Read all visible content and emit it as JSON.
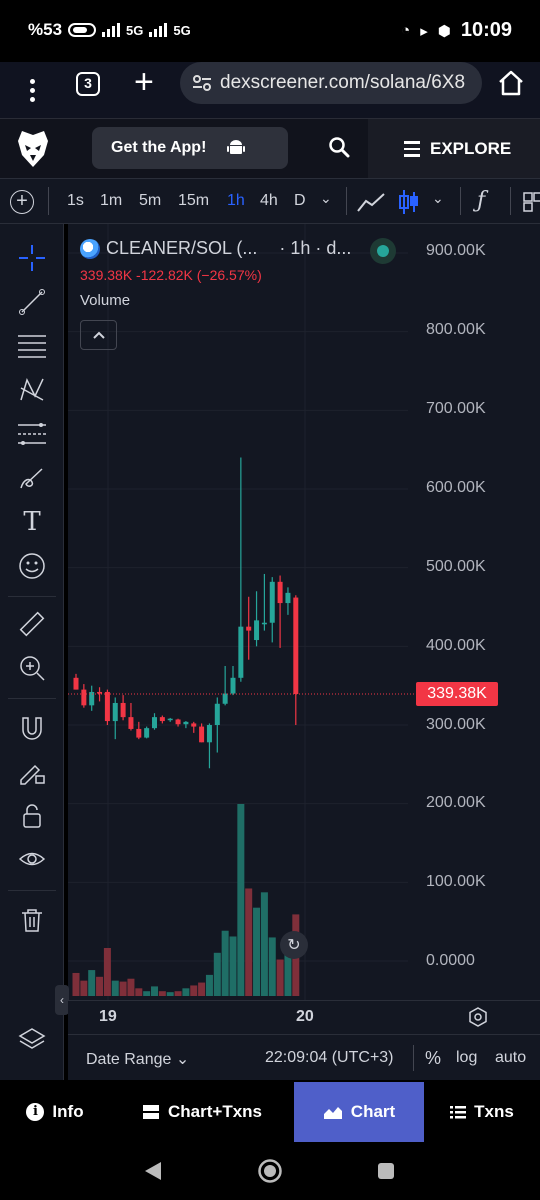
{
  "status_bar": {
    "battery_pct": "%53",
    "net1": "5G",
    "net2": "5G",
    "time": "10:09"
  },
  "browser": {
    "tab_count": "3",
    "url": "dexscreener.com/solana/6X8"
  },
  "site_header": {
    "get_app_label": "Get the App!",
    "explore_label": "EXPLORE"
  },
  "toolbar": {
    "timeframes": [
      "1s",
      "1m",
      "5m",
      "15m",
      "1h",
      "4h",
      "D"
    ],
    "active_timeframe": "1h"
  },
  "chart_header": {
    "symbol": "CLEANER/SOL (...",
    "interval": "· 1h · d...",
    "ohlc_line": "339.38K  -122.82K  (−26.57%)",
    "volume_label": "Volume"
  },
  "price_axis": [
    "900.00K",
    "800.00K",
    "700.00K",
    "600.00K",
    "500.00K",
    "400.00K",
    "300.00K",
    "200.00K",
    "100.00K",
    "0.0000"
  ],
  "last_price_label": "339.38K",
  "time_axis": [
    "19",
    "20"
  ],
  "chart_footer": {
    "date_range": "Date Range",
    "clock": "22:09:04 (UTC+3)",
    "percent": "%",
    "log": "log",
    "auto": "auto"
  },
  "app_tabs": [
    {
      "label": "Info",
      "active": false
    },
    {
      "label": "Chart+Txns",
      "active": false
    },
    {
      "label": "Chart",
      "active": true
    },
    {
      "label": "Txns",
      "active": false
    }
  ],
  "colors": {
    "up": "#26a69a",
    "down": "#f23645",
    "volume_up": "#1f6e66",
    "volume_down": "#7f2f3a",
    "active_tab": "#4f5fc9",
    "accent": "#2962ff"
  },
  "chart_data": {
    "type": "candlestick",
    "interval": "1h",
    "ylim": [
      0,
      900000
    ],
    "last_price": 339380,
    "candles": [
      {
        "o": 360000,
        "h": 365000,
        "l": 345000,
        "c": 345000
      },
      {
        "o": 345000,
        "h": 352000,
        "l": 322000,
        "c": 325000
      },
      {
        "o": 325000,
        "h": 350000,
        "l": 318000,
        "c": 342000
      },
      {
        "o": 342000,
        "h": 348000,
        "l": 330000,
        "c": 340000
      },
      {
        "o": 342000,
        "h": 345000,
        "l": 300000,
        "c": 305000
      },
      {
        "o": 305000,
        "h": 335000,
        "l": 282000,
        "c": 328000
      },
      {
        "o": 328000,
        "h": 338000,
        "l": 306000,
        "c": 310000
      },
      {
        "o": 310000,
        "h": 328000,
        "l": 293000,
        "c": 295000
      },
      {
        "o": 295000,
        "h": 304000,
        "l": 282000,
        "c": 284000
      },
      {
        "o": 284000,
        "h": 298000,
        "l": 283000,
        "c": 296000
      },
      {
        "o": 296000,
        "h": 315000,
        "l": 294000,
        "c": 310000
      },
      {
        "o": 310000,
        "h": 312000,
        "l": 302000,
        "c": 305000
      },
      {
        "o": 307000,
        "h": 309000,
        "l": 304000,
        "c": 308000
      },
      {
        "o": 307000,
        "h": 308000,
        "l": 298000,
        "c": 301000
      },
      {
        "o": 301000,
        "h": 305000,
        "l": 296000,
        "c": 304000
      },
      {
        "o": 302000,
        "h": 304000,
        "l": 290000,
        "c": 298000
      },
      {
        "o": 298000,
        "h": 302000,
        "l": 278000,
        "c": 278000
      },
      {
        "o": 278000,
        "h": 302000,
        "l": 245000,
        "c": 300000
      },
      {
        "o": 300000,
        "h": 335000,
        "l": 265000,
        "c": 327000
      },
      {
        "o": 327000,
        "h": 375000,
        "l": 325000,
        "c": 340000
      },
      {
        "o": 340000,
        "h": 375000,
        "l": 338000,
        "c": 360000
      },
      {
        "o": 360000,
        "h": 640000,
        "l": 355000,
        "c": 425000
      },
      {
        "o": 425000,
        "h": 463000,
        "l": 383000,
        "c": 420000
      },
      {
        "o": 408000,
        "h": 470000,
        "l": 400000,
        "c": 433000
      },
      {
        "o": 428000,
        "h": 492000,
        "l": 420000,
        "c": 430000
      },
      {
        "o": 430000,
        "h": 488000,
        "l": 405000,
        "c": 482000
      },
      {
        "o": 482000,
        "h": 490000,
        "l": 398000,
        "c": 455000
      },
      {
        "o": 455000,
        "h": 475000,
        "l": 440000,
        "c": 468000
      },
      {
        "o": 462000,
        "h": 465000,
        "l": 300000,
        "c": 339380
      }
    ],
    "volume": [
      24000,
      16000,
      27000,
      20000,
      50000,
      16000,
      15000,
      18000,
      8000,
      5000,
      10000,
      5000,
      4000,
      5000,
      8000,
      11000,
      14000,
      22000,
      45000,
      68000,
      62000,
      200000,
      112000,
      92000,
      108000,
      61000,
      38000,
      55000,
      85000
    ]
  }
}
